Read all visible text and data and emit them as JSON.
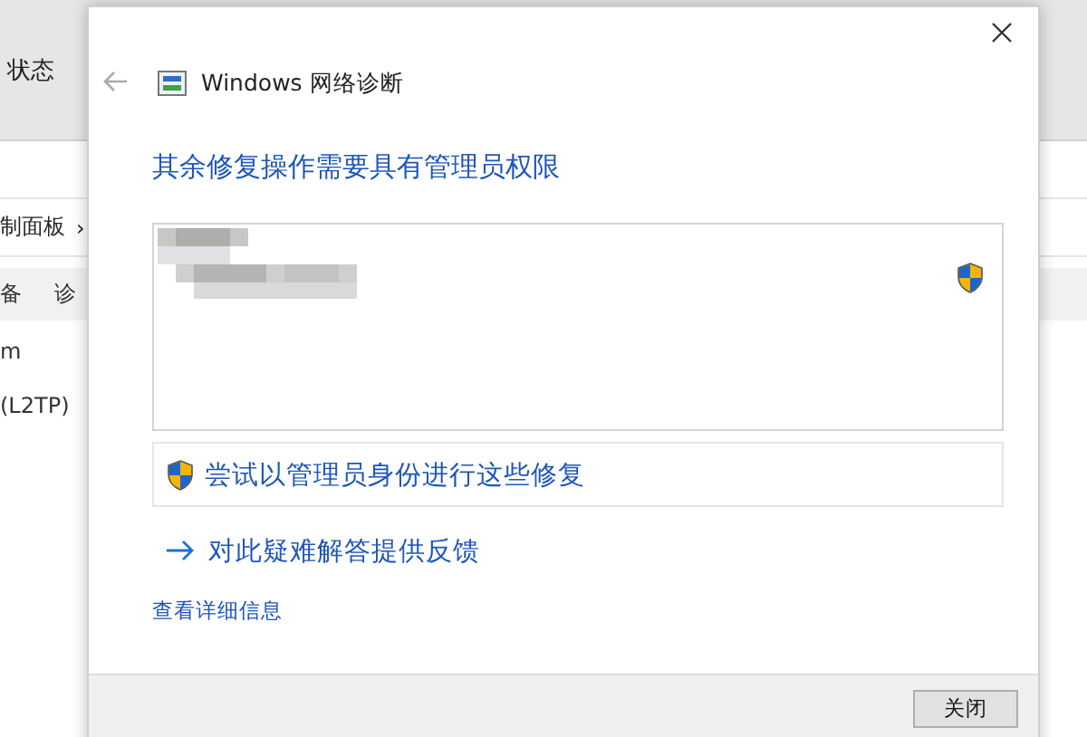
{
  "background_window": {
    "header": "状态",
    "breadcrumb": "制面板",
    "breadcrumb_separator": "›",
    "toolbar": [
      "备",
      "诊"
    ],
    "items": [
      "m",
      "(L2TP)"
    ]
  },
  "dialog": {
    "title": "Windows 网络诊断",
    "heading": "其余修复操作需要具有管理员权限",
    "admin_action": "尝试以管理员身份进行这些修复",
    "feedback": "对此疑难解答提供反馈",
    "details_link": "查看详细信息",
    "close_button": "关闭"
  }
}
